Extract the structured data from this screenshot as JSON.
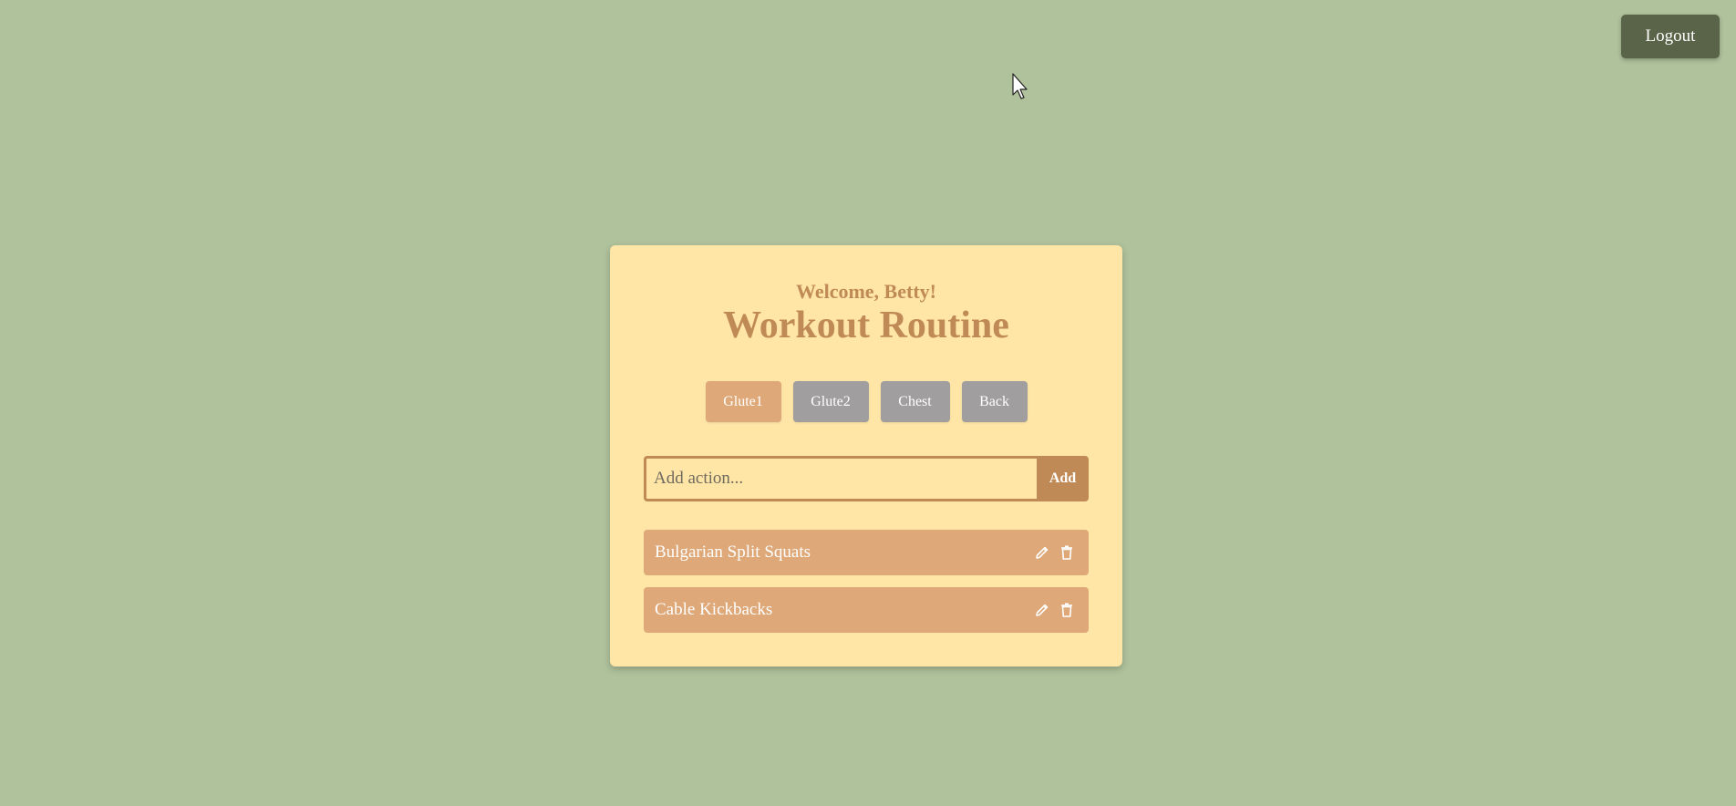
{
  "header": {
    "logout_label": "Logout"
  },
  "card": {
    "welcome": "Welcome, Betty!",
    "title": "Workout Routine",
    "tabs": [
      {
        "label": "Glute1",
        "active": true
      },
      {
        "label": "Glute2",
        "active": false
      },
      {
        "label": "Chest",
        "active": false
      },
      {
        "label": "Back",
        "active": false
      }
    ],
    "add_input": {
      "placeholder": "Add action...",
      "value": ""
    },
    "add_label": "Add",
    "items": [
      {
        "label": "Bulgarian Split Squats",
        "edit_icon": "pencil-icon",
        "delete_icon": "trash-icon"
      },
      {
        "label": "Cable Kickbacks",
        "edit_icon": "pencil-icon",
        "delete_icon": "trash-icon"
      }
    ]
  },
  "colors": {
    "background": "#afc29c",
    "card": "#ffe6a7",
    "accent": "#c08a56",
    "item": "#dea878",
    "tab_inactive": "#a09e9e",
    "logout": "#5a6448"
  }
}
